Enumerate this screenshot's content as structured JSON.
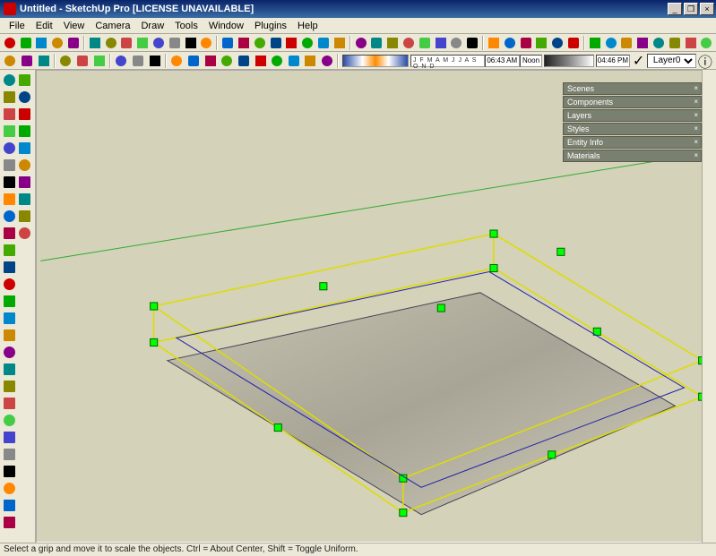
{
  "title": "Untitled - SketchUp Pro [LICENSE UNAVAILABLE]",
  "menu": [
    "File",
    "Edit",
    "View",
    "Camera",
    "Draw",
    "Tools",
    "Window",
    "Plugins",
    "Help"
  ],
  "toolbar_icons_row1": [
    "select",
    "delete",
    "eraser",
    "paint",
    "rect",
    "circle",
    "arc",
    "pencil",
    "line",
    "polygon",
    "freehand",
    "move",
    "rotate",
    "scale",
    "offset",
    "pushpull",
    "followme",
    "tape",
    "protractor",
    "dims",
    "text",
    "3dtext",
    "axes",
    "sectionplane",
    "orbit",
    "pan",
    "zoom",
    "zoomwin",
    "zoomext",
    "prev",
    "next",
    "iso",
    "top",
    "front",
    "right",
    "xray",
    "back",
    "shade1",
    "shade2",
    "shade3",
    "shade4",
    "getmodel",
    "share"
  ],
  "toolbar_icons_row2": [
    "new",
    "open",
    "save",
    "cut",
    "copy",
    "paste",
    "undo",
    "redo",
    "print",
    "model-info",
    "mat1",
    "mat2",
    "mat3",
    "mat4",
    "mat5",
    "mat6",
    "mat7",
    "mat8",
    "mat9"
  ],
  "time": {
    "start": "06:43 AM",
    "noon": "Noon",
    "end": "04:46 PM",
    "months": "J F M A M J J A S O N D"
  },
  "layer": {
    "selected": "Layer0"
  },
  "left_tools": [
    "select",
    "eraser",
    "paint",
    "rect",
    "circle",
    "arc",
    "pencil",
    "poly",
    "free",
    "move",
    "rotate",
    "scale",
    "offset",
    "push",
    "follow",
    "tape",
    "prot",
    "axes",
    "dims",
    "text",
    "3dt",
    "sect",
    "orbit",
    "pan",
    "zoom",
    "zwin",
    "zext",
    "walk",
    "look",
    "pos",
    "sandbox1",
    "sandbox2",
    "smoove",
    "stamp",
    "drape",
    "addDetail",
    "flip"
  ],
  "panels": [
    "Scenes",
    "Components",
    "Layers",
    "Styles",
    "Entity Info",
    "Materials"
  ],
  "status": "Select a grip and move it to scale the objects. Ctrl = About Center, Shift = Toggle Uniform."
}
